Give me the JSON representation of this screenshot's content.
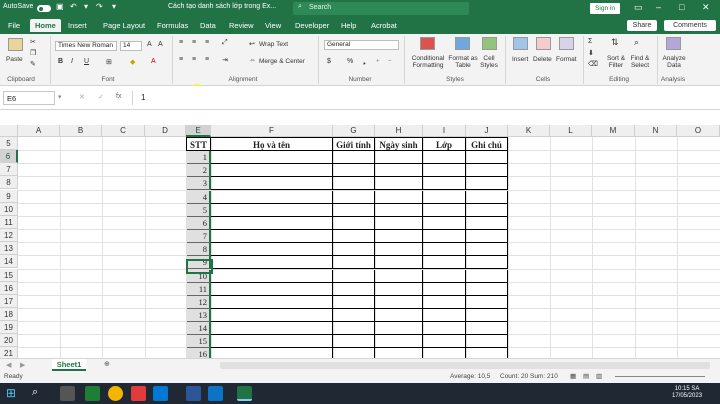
{
  "titlebar": {
    "autosave": "AutoSave",
    "toggle": "Off",
    "doc_title": "Cách tạo danh sách lớp trong Ex...",
    "search": "Search",
    "signin": "Sign in"
  },
  "tabs": [
    "File",
    "Home",
    "Insert",
    "Page Layout",
    "Formulas",
    "Data",
    "Review",
    "View",
    "Developer",
    "Help",
    "Acrobat"
  ],
  "share": "Share",
  "comments": "Comments",
  "ribbon": {
    "clipboard": {
      "paste": "Paste",
      "label": "Clipboard"
    },
    "font": {
      "name": "Times New Roman",
      "size": "14",
      "label": "Font",
      "bold": "B",
      "italic": "I",
      "underline": "U"
    },
    "alignment": {
      "wrap": "Wrap Text",
      "merge": "Merge & Center",
      "label": "Alignment"
    },
    "number": {
      "format": "General",
      "label": "Number",
      "dollar": "$",
      "percent": "%"
    },
    "styles": {
      "cond": "Conditional Formatting",
      "table": "Format as Table",
      "cell": "Cell Styles",
      "label": "Styles"
    },
    "cells": {
      "insert": "Insert",
      "delete": "Delete",
      "format": "Format",
      "label": "Cells"
    },
    "editing": {
      "sort": "Sort & Filter",
      "find": "Find & Select",
      "label": "Editing"
    },
    "analysis": {
      "analyze": "Analyze Data",
      "label": "Analysis"
    }
  },
  "formula_bar": {
    "namebox": "E6",
    "fx": "fx",
    "value": "1"
  },
  "columns": [
    "A",
    "B",
    "C",
    "D",
    "E",
    "F",
    "G",
    "H",
    "I",
    "J",
    "K",
    "L",
    "M",
    "N",
    "O"
  ],
  "rows": [
    "5",
    "6",
    "7",
    "8",
    "9",
    "10",
    "11",
    "12",
    "13",
    "14",
    "15",
    "16",
    "17",
    "18",
    "19",
    "20",
    "21"
  ],
  "table_headers": [
    "STT",
    "Họ và tên",
    "Giới tính",
    "Ngày sinh",
    "Lớp",
    "Ghi chú"
  ],
  "stt": [
    "1",
    "2",
    "3",
    "4",
    "5",
    "6",
    "7",
    "8",
    "9",
    "10",
    "11",
    "12",
    "13",
    "14",
    "15",
    "16"
  ],
  "sheet": {
    "name": "Sheet1"
  },
  "status": {
    "ready": "Ready",
    "average": "Average: 10,5",
    "count": "Count: 20",
    "sum": "Sum: 210"
  },
  "clock": {
    "time": "10:15 SA",
    "date": "17/05/2023"
  }
}
